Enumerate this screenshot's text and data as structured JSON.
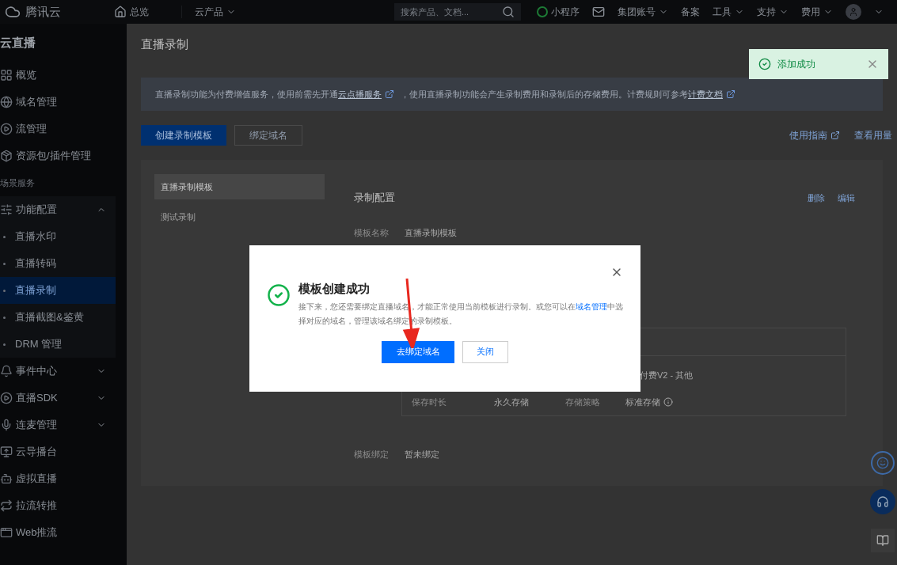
{
  "topbar": {
    "logo": "腾讯云",
    "home": "总览",
    "products": "云产品",
    "search": {
      "placeholder": "搜索产品、文档..."
    },
    "items": [
      {
        "label": "小程序",
        "kind": "miniapp"
      },
      {
        "kind": "mail"
      },
      {
        "label": "集团账号",
        "kind": "menu"
      },
      {
        "label": "备案",
        "kind": "plain"
      },
      {
        "label": "工具",
        "kind": "menu"
      },
      {
        "label": "支持",
        "kind": "menu"
      },
      {
        "label": "费用",
        "kind": "menu"
      }
    ]
  },
  "sidebar": {
    "title": "云直播",
    "items": [
      {
        "label": "概览",
        "selected": false
      },
      {
        "label": "域名管理",
        "selected": false
      },
      {
        "label": "流管理",
        "selected": false
      },
      {
        "label": "资源包/插件管理",
        "selected": false
      },
      {
        "label": "场景服务",
        "kind": "section"
      },
      {
        "label": "功能配置",
        "expanded": true,
        "children": [
          {
            "label": "直播水印",
            "selected": false
          },
          {
            "label": "直播转码",
            "selected": false
          },
          {
            "label": "直播录制",
            "selected": true
          },
          {
            "label": "直播截图&鉴黄",
            "selected": false
          },
          {
            "label": "DRM 管理",
            "selected": false
          }
        ]
      },
      {
        "label": "事件中心",
        "expanded": false
      },
      {
        "label": "直播SDK",
        "expanded": false
      },
      {
        "label": "连麦管理",
        "expanded": false
      },
      {
        "label": "云导播台",
        "selected": false
      },
      {
        "label": "虚拟直播",
        "selected": false
      },
      {
        "label": "拉流转推",
        "selected": false
      },
      {
        "label": "Web推流",
        "selected": false
      }
    ]
  },
  "page": {
    "title": "直播录制",
    "banner": [
      {
        "kind": "text",
        "text": "直播录制功能为付费增值服务，使用前需先开通"
      },
      {
        "kind": "link",
        "text": "云点播服务"
      },
      {
        "kind": "text",
        "text": "，使用直播录制功能会产生录制费用和录制后的存储费用。计费规则可参考"
      },
      {
        "kind": "link",
        "text": "计费文档"
      }
    ],
    "actions": [
      {
        "label": "创建录制模板",
        "primary": true
      },
      {
        "label": "绑定域名",
        "primary": false
      }
    ],
    "links": [
      {
        "label": "使用指南",
        "external": true
      },
      {
        "label": "查看用量",
        "external": false
      }
    ],
    "tabs": [
      {
        "label": "直播录制模板",
        "selected": true
      },
      {
        "label": "测试录制",
        "selected": false
      }
    ],
    "config": {
      "title": "录制配置",
      "actions": [
        "删除",
        "编辑"
      ],
      "name_label": "模板名称",
      "name_value": "直播录制模板",
      "table_cells": [
        "付费V2 - 其他",
        "保存时长",
        "永久存储",
        "存储策略",
        "标准存储"
      ],
      "bind_label": "模板绑定",
      "bind_value": "暂未绑定"
    }
  },
  "toast": {
    "text": "添加成功"
  },
  "dialog": {
    "title": "模板创建成功",
    "message": [
      {
        "kind": "text",
        "text": "接下来，您还需要绑定直播域名，才能正常使用当前模板进行录制。或您可以在"
      },
      {
        "kind": "link",
        "text": "域名管理"
      },
      {
        "kind": "text",
        "text": "中选择对应的域名，管理该域名绑定的录制模板。"
      }
    ],
    "buttons": [
      {
        "label": "去绑定域名",
        "primary": true
      },
      {
        "label": "关闭",
        "primary": false
      }
    ]
  }
}
